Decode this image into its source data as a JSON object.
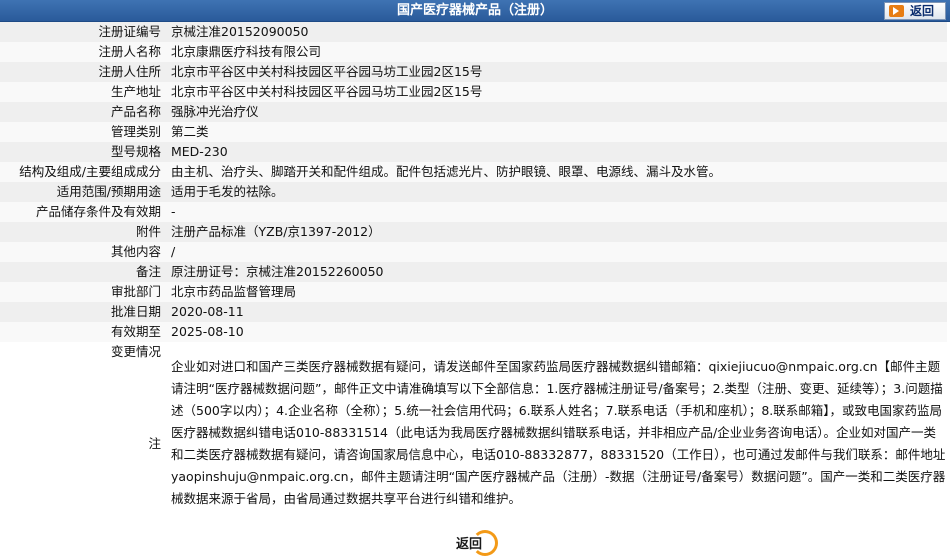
{
  "header": {
    "title": "国产医疗器械产品（注册）",
    "back_label": "返回"
  },
  "rows": [
    {
      "label": "注册证编号",
      "value": "京械注准20152090050"
    },
    {
      "label": "注册人名称",
      "value": "北京康鼎医疗科技有限公司"
    },
    {
      "label": "注册人住所",
      "value": "北京市平谷区中关村科技园区平谷园马坊工业园2区15号"
    },
    {
      "label": "生产地址",
      "value": "北京市平谷区中关村科技园区平谷园马坊工业园2区15号"
    },
    {
      "label": "产品名称",
      "value": "强脉冲光治疗仪"
    },
    {
      "label": "管理类别",
      "value": "第二类"
    },
    {
      "label": "型号规格",
      "value": "MED-230"
    },
    {
      "label": "结构及组成/主要组成成分",
      "value": "由主机、治疗头、脚踏开关和配件组成。配件包括滤光片、防护眼镜、眼罩、电源线、漏斗及水管。"
    },
    {
      "label": "适用范围/预期用途",
      "value": "适用于毛发的祛除。"
    },
    {
      "label": "产品储存条件及有效期",
      "value": "-"
    },
    {
      "label": "附件",
      "value": "注册产品标准（YZB/京1397-2012）"
    },
    {
      "label": "其他内容",
      "value": "/"
    },
    {
      "label": "备注",
      "value": "原注册证号：京械注准20152260050"
    },
    {
      "label": "审批部门",
      "value": "北京市药品监督管理局"
    },
    {
      "label": "批准日期",
      "value": "2020-08-11"
    },
    {
      "label": "有效期至",
      "value": "2025-08-10"
    }
  ],
  "change_label": "变更情况",
  "note": {
    "label": "注",
    "text": "企业如对进口和国产三类医疗器械数据有疑问，请发送邮件至国家药监局医疗器械数据纠错邮箱：qixiejiucuo@nmpaic.org.cn【邮件主题请注明“医疗器械数据问题”，邮件正文中请准确填写以下全部信息：1.医疗器械注册证号/备案号；2.类型（注册、变更、延续等）；3.问题描述（500字以内）；4.企业名称（全称）；5.统一社会信用代码；6.联系人姓名；7.联系电话（手机和座机）；8.联系邮箱】，或致电国家药监局医疗器械数据纠错电话010-88331514（此电话为我局医疗器械数据纠错联系电话，并非相应产品/企业业务咨询电话）。企业如对国产一类和二类医疗器械数据有疑问，请咨询国家局信息中心，电话010-88332877，88331520（工作日），也可通过发邮件与我们联系：邮件地址yaopinshuju@nmpaic.org.cn，邮件主题请注明“国产医疗器械产品（注册）-数据（注册证号/备案号）数据问题”。国产一类和二类医疗器械数据来源于省局，由省局通过数据共享平台进行纠错和维护。"
  },
  "footer": {
    "back_label": "返回"
  }
}
